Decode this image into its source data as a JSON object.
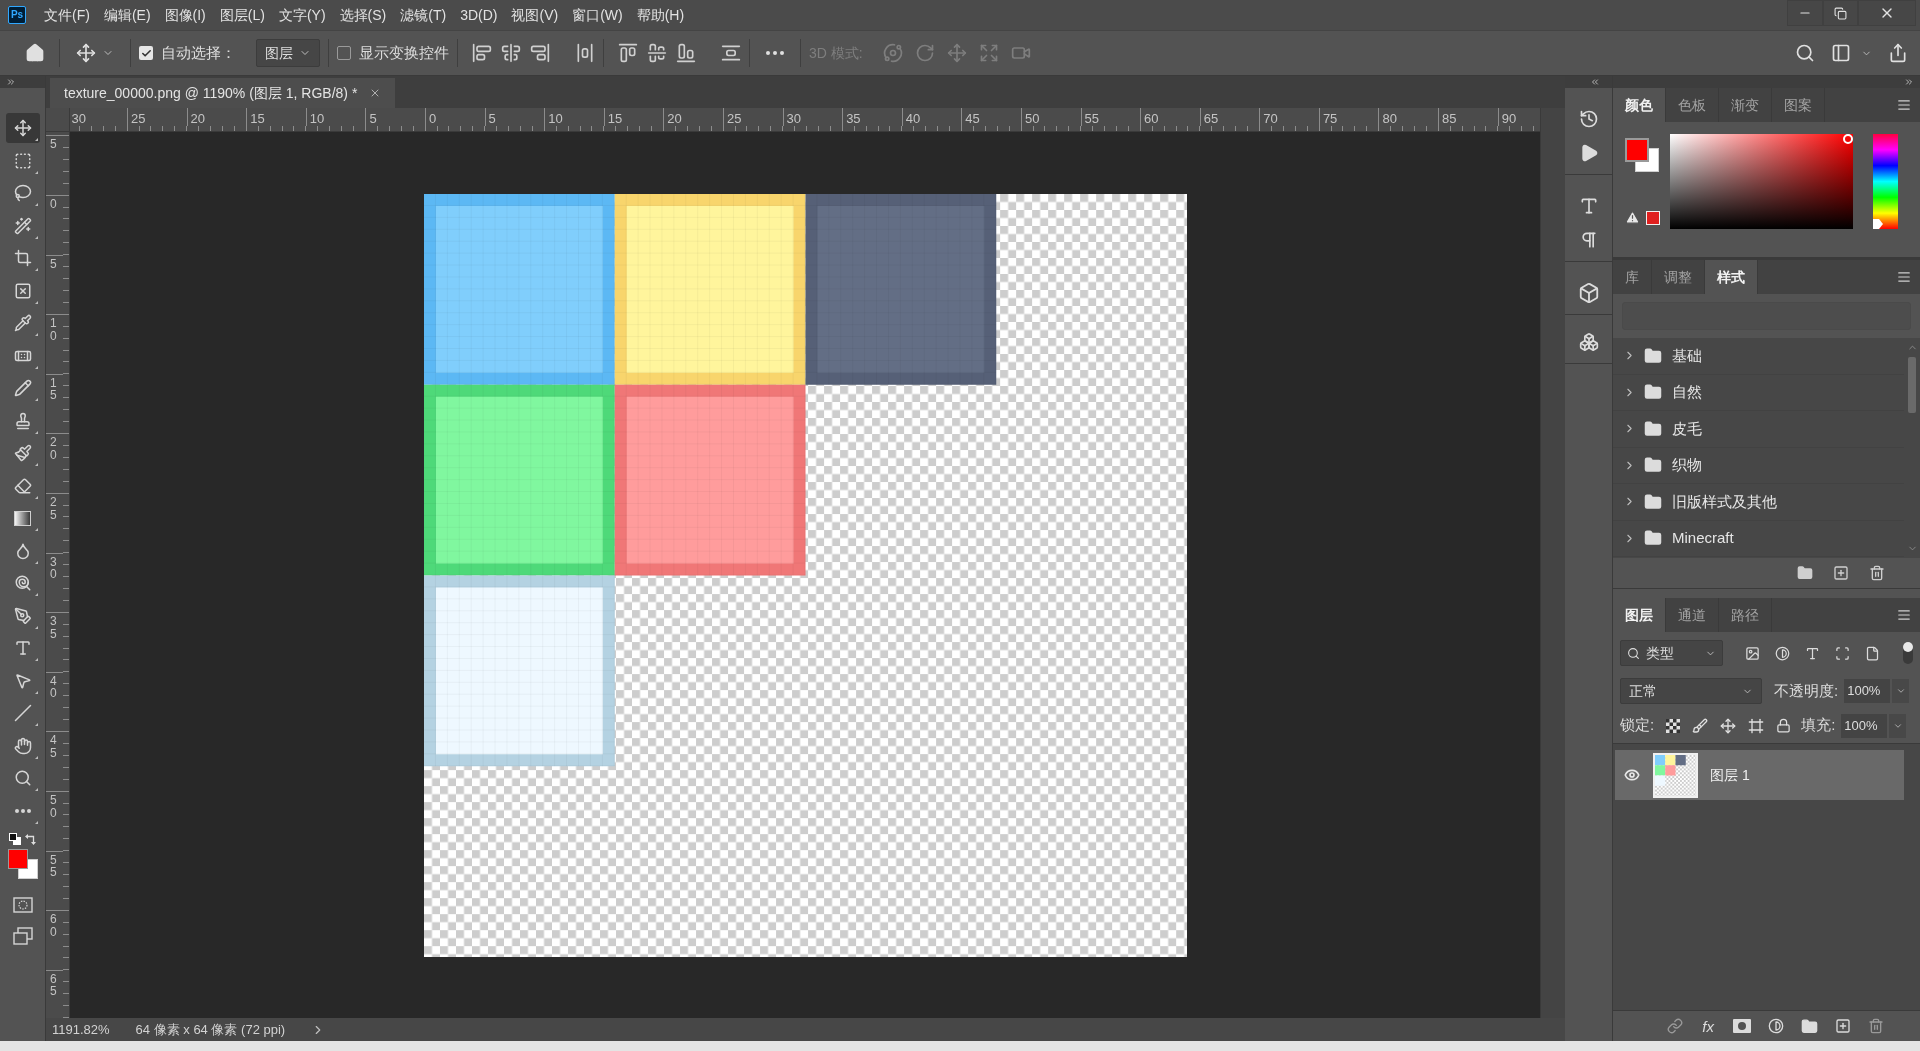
{
  "app": {
    "logo": "Ps"
  },
  "menu": [
    "文件(F)",
    "编辑(E)",
    "图像(I)",
    "图层(L)",
    "文字(Y)",
    "选择(S)",
    "滤镜(T)",
    "3D(D)",
    "视图(V)",
    "窗口(W)",
    "帮助(H)"
  ],
  "options_bar": {
    "auto_select": {
      "label": "自动选择：",
      "checked": true
    },
    "auto_select_target": "图层",
    "transform_controls": {
      "label": "显示变换控件",
      "checked": false
    },
    "mode_3d": {
      "label": "3D 模式:",
      "disabled": true
    }
  },
  "tools": [
    {
      "kind": "move",
      "selected": true
    },
    {
      "kind": "marquee",
      "selected": false
    },
    {
      "kind": "lasso",
      "selected": false
    },
    {
      "kind": "magic_wand",
      "selected": false
    },
    {
      "kind": "crop",
      "selected": false
    },
    {
      "kind": "frame",
      "selected": false
    },
    {
      "kind": "eyedropper",
      "selected": false
    },
    {
      "kind": "healing",
      "selected": false
    },
    {
      "kind": "brush",
      "selected": false
    },
    {
      "kind": "stamp",
      "selected": false
    },
    {
      "kind": "history_brush",
      "selected": false
    },
    {
      "kind": "eraser",
      "selected": false
    },
    {
      "kind": "gradient",
      "selected": false
    },
    {
      "kind": "blur",
      "selected": false
    },
    {
      "kind": "dodge",
      "selected": false
    },
    {
      "kind": "pen",
      "selected": false
    },
    {
      "kind": "type",
      "selected": false
    },
    {
      "kind": "path_select",
      "selected": false
    },
    {
      "kind": "line",
      "selected": false
    },
    {
      "kind": "hand",
      "selected": false
    },
    {
      "kind": "zoom",
      "selected": false
    },
    {
      "kind": "more",
      "selected": false
    }
  ],
  "document": {
    "tab_title": "texture_00000.png @ 1190% (图层 1, RGB/8) *",
    "ruler_h": [
      "30",
      "25",
      "20",
      "15",
      "10",
      "5",
      "0",
      "5",
      "10",
      "15",
      "20",
      "25",
      "30",
      "35",
      "40",
      "45",
      "50",
      "55",
      "60",
      "65",
      "70",
      "75",
      "80",
      "85",
      "90"
    ],
    "ruler_v": [
      "5",
      "0",
      "5",
      "10",
      "15",
      "20",
      "25",
      "30",
      "35",
      "40",
      "45",
      "50",
      "55",
      "60",
      "65"
    ]
  },
  "status_bar": {
    "zoom": "1191.82%",
    "doc_info": "64 像素 x 64 像素 (72 ppi)"
  },
  "color_panel": {
    "tabs": [
      {
        "label": "颜色",
        "selected": true
      },
      {
        "label": "色板",
        "selected": false
      },
      {
        "label": "渐变",
        "selected": false
      },
      {
        "label": "图案",
        "selected": false
      }
    ],
    "hue_slider": {
      "level": 0
    }
  },
  "styles_panel": {
    "tabs": [
      {
        "label": "库",
        "selected": false
      },
      {
        "label": "调整",
        "selected": false
      },
      {
        "label": "样式",
        "selected": true
      }
    ],
    "groups": [
      {
        "label": "基础",
        "expanded": false
      },
      {
        "label": "自然",
        "expanded": false
      },
      {
        "label": "皮毛",
        "expanded": false
      },
      {
        "label": "织物",
        "expanded": false
      },
      {
        "label": "旧版样式及其他",
        "expanded": false
      },
      {
        "label": "Minecraft",
        "expanded": false
      }
    ]
  },
  "layers_panel": {
    "tabs": [
      {
        "label": "图层",
        "selected": true
      },
      {
        "label": "通道",
        "selected": false
      },
      {
        "label": "路径",
        "selected": false
      }
    ],
    "filter": {
      "label": "类型",
      "toggle_on": true
    },
    "blend_mode": "正常",
    "opacity": {
      "label": "不透明度:",
      "value": "100%"
    },
    "lock_label": "锁定:",
    "fill": {
      "label": "填充:",
      "value": "100%"
    },
    "layers": [
      {
        "name": "图层 1",
        "visible": true,
        "selected": true
      }
    ],
    "fx_label": "fx"
  }
}
